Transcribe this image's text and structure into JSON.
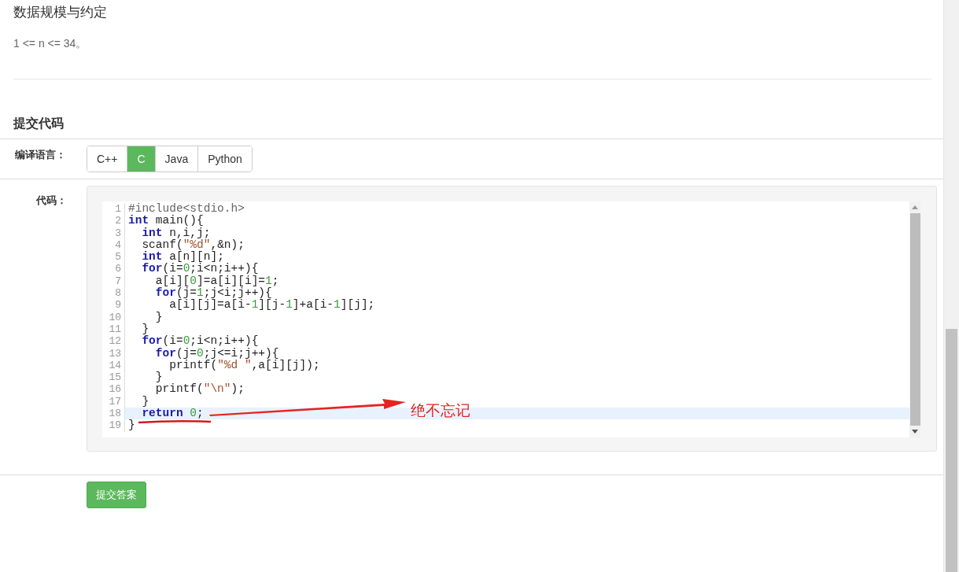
{
  "section": {
    "title": "数据规模与约定",
    "text": "1 <= n <= 34。"
  },
  "submit_section": {
    "title": "提交代码"
  },
  "language": {
    "label": "编译语言：",
    "options": [
      {
        "label": "C++",
        "selected": false
      },
      {
        "label": "C",
        "selected": true
      },
      {
        "label": "Java",
        "selected": false
      },
      {
        "label": "Python",
        "selected": false
      }
    ]
  },
  "code": {
    "label": "代码：",
    "lines": [
      {
        "number": "1",
        "active": false,
        "tokens": [
          {
            "text": "#include<stdio.h>",
            "kind": "meta"
          }
        ]
      },
      {
        "number": "2",
        "active": false,
        "tokens": [
          {
            "text": "int",
            "kind": "keyword"
          },
          {
            "text": " main(){",
            "kind": "plain"
          }
        ]
      },
      {
        "number": "3",
        "active": false,
        "tokens": [
          {
            "text": "  int",
            "kind": "keyword"
          },
          {
            "text": " n,i,j;",
            "kind": "plain"
          }
        ]
      },
      {
        "number": "4",
        "active": false,
        "tokens": [
          {
            "text": "  scanf(",
            "kind": "plain"
          },
          {
            "text": "\"%d\"",
            "kind": "string"
          },
          {
            "text": ",&n);",
            "kind": "plain"
          }
        ]
      },
      {
        "number": "5",
        "active": false,
        "tokens": [
          {
            "text": "  int",
            "kind": "keyword"
          },
          {
            "text": " a[n][n];",
            "kind": "plain"
          }
        ]
      },
      {
        "number": "6",
        "active": false,
        "tokens": [
          {
            "text": "  for",
            "kind": "keyword"
          },
          {
            "text": "(i=",
            "kind": "plain"
          },
          {
            "text": "0",
            "kind": "number"
          },
          {
            "text": ";i<n;i++){",
            "kind": "plain"
          }
        ]
      },
      {
        "number": "7",
        "active": false,
        "tokens": [
          {
            "text": "    a[i][",
            "kind": "plain"
          },
          {
            "text": "0",
            "kind": "number"
          },
          {
            "text": "]=a[i][i]=",
            "kind": "plain"
          },
          {
            "text": "1",
            "kind": "number"
          },
          {
            "text": ";",
            "kind": "plain"
          }
        ]
      },
      {
        "number": "8",
        "active": false,
        "tokens": [
          {
            "text": "    for",
            "kind": "keyword"
          },
          {
            "text": "(j=",
            "kind": "plain"
          },
          {
            "text": "1",
            "kind": "number"
          },
          {
            "text": ";j<i;j++){",
            "kind": "plain"
          }
        ]
      },
      {
        "number": "9",
        "active": false,
        "tokens": [
          {
            "text": "      a[i][j]=a[i-",
            "kind": "plain"
          },
          {
            "text": "1",
            "kind": "number"
          },
          {
            "text": "][j-",
            "kind": "plain"
          },
          {
            "text": "1",
            "kind": "number"
          },
          {
            "text": "]+a[i-",
            "kind": "plain"
          },
          {
            "text": "1",
            "kind": "number"
          },
          {
            "text": "][j];",
            "kind": "plain"
          }
        ]
      },
      {
        "number": "10",
        "active": false,
        "tokens": [
          {
            "text": "    }",
            "kind": "plain"
          }
        ]
      },
      {
        "number": "11",
        "active": false,
        "tokens": [
          {
            "text": "  }",
            "kind": "plain"
          }
        ]
      },
      {
        "number": "12",
        "active": false,
        "tokens": [
          {
            "text": "  for",
            "kind": "keyword"
          },
          {
            "text": "(i=",
            "kind": "plain"
          },
          {
            "text": "0",
            "kind": "number"
          },
          {
            "text": ";i<n;i++){",
            "kind": "plain"
          }
        ]
      },
      {
        "number": "13",
        "active": false,
        "tokens": [
          {
            "text": "    for",
            "kind": "keyword"
          },
          {
            "text": "(j=",
            "kind": "plain"
          },
          {
            "text": "0",
            "kind": "number"
          },
          {
            "text": ";j<=i;j++){",
            "kind": "plain"
          }
        ]
      },
      {
        "number": "14",
        "active": false,
        "tokens": [
          {
            "text": "      printf(",
            "kind": "plain"
          },
          {
            "text": "\"%d \"",
            "kind": "string"
          },
          {
            "text": ",a[i][j]);",
            "kind": "plain"
          }
        ]
      },
      {
        "number": "15",
        "active": false,
        "tokens": [
          {
            "text": "    }",
            "kind": "plain"
          }
        ]
      },
      {
        "number": "16",
        "active": false,
        "tokens": [
          {
            "text": "    printf(",
            "kind": "plain"
          },
          {
            "text": "\"\\n\"",
            "kind": "string"
          },
          {
            "text": ");",
            "kind": "plain"
          }
        ]
      },
      {
        "number": "17",
        "active": false,
        "tokens": [
          {
            "text": "  }",
            "kind": "plain"
          }
        ]
      },
      {
        "number": "18",
        "active": true,
        "tokens": [
          {
            "text": "  return",
            "kind": "keyword"
          },
          {
            "text": " 0",
            "kind": "number"
          },
          {
            "text": ";",
            "kind": "plain"
          }
        ]
      },
      {
        "number": "19",
        "active": false,
        "tokens": [
          {
            "text": "}",
            "kind": "plain"
          }
        ]
      }
    ]
  },
  "annotation": {
    "text": "绝不忘记"
  },
  "submit_button": "提交答案"
}
